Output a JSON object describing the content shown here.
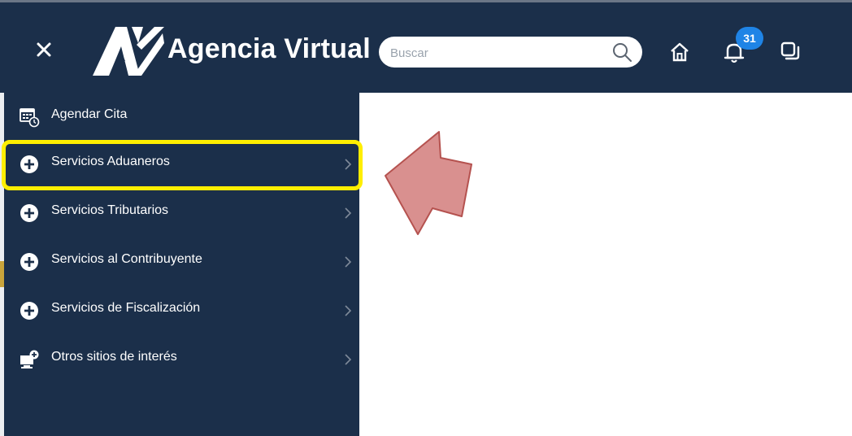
{
  "header": {
    "title": "Agencia Virtual",
    "close_icon": "close-icon",
    "search": {
      "placeholder": "Buscar",
      "value": ""
    },
    "notifications_count": "31",
    "icons": [
      "search-icon",
      "home-icon",
      "bell-icon",
      "windows-icon"
    ]
  },
  "sidebar": {
    "items": [
      {
        "label": "Agendar Cita",
        "icon": "calendar-clock-icon",
        "has_submenu": false
      },
      {
        "label": "Servicios Aduaneros",
        "icon": "plus-circle-icon",
        "has_submenu": true
      },
      {
        "label": "Servicios Tributarios",
        "icon": "plus-circle-icon",
        "has_submenu": true
      },
      {
        "label": "Servicios al Contribuyente",
        "icon": "plus-circle-icon",
        "has_submenu": true
      },
      {
        "label": "Servicios de Fiscalización",
        "icon": "plus-circle-icon",
        "has_submenu": true
      },
      {
        "label": "Otros sitios de interés",
        "icon": "monitor-add-icon",
        "has_submenu": true
      }
    ]
  },
  "annotation": {
    "highlighted_item": "Servicios Aduaneros",
    "highlight_color": "#ffee00",
    "arrow_color": "#d9908f"
  },
  "colors": {
    "navy": "#1b2f4a",
    "badge": "#1f84e6"
  }
}
